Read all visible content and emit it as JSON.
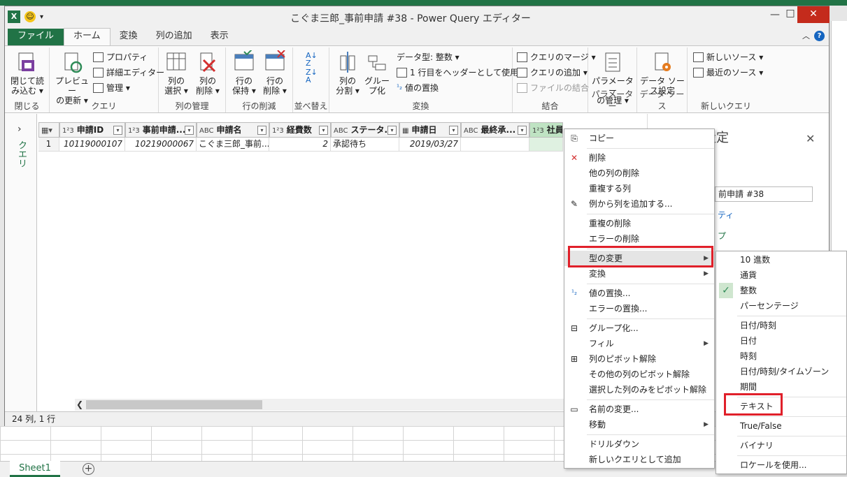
{
  "window": {
    "title": "こぐま三郎_事前申請 #38 - Power Query エディター",
    "min": "—",
    "max": "□",
    "close": "✕"
  },
  "tabs": [
    {
      "label": "ファイル"
    },
    {
      "label": "ホーム"
    },
    {
      "label": "変換"
    },
    {
      "label": "列の追加"
    },
    {
      "label": "表示"
    }
  ],
  "ribbon": {
    "close_load": "閉じて読\nみ込む ▾",
    "group_close": "閉じる",
    "preview_refresh": "プレビュー\nの更新 ▾",
    "properties": "プロパティ",
    "advanced_editor": "詳細エディター",
    "manage": "管理 ▾",
    "group_query": "クエリ",
    "choose_columns": "列の\n選択 ▾",
    "remove_columns": "列の\n削除 ▾",
    "group_manage_cols": "列の管理",
    "keep_rows": "行の\n保持 ▾",
    "remove_rows": "行の\n削除 ▾",
    "group_reduce_rows": "行の削減",
    "group_sort": "並べ替え",
    "split_column": "列の\n分割 ▾",
    "group_by": "グルー\nプ化",
    "data_type": "データ型: 整数 ▾",
    "use_first_row": "1 行目をヘッダーとして使用 ▾",
    "replace_values": "値の置換",
    "group_transform": "変換",
    "merge_queries": "クエリのマージ ▾",
    "append_queries": "クエリの追加 ▾",
    "combine_files": "ファイルの結合",
    "group_combine": "結合",
    "manage_params": "パラメーター\nの管理 ▾",
    "group_params": "パラメーター",
    "data_source_settings": "データ ソー\nス設定",
    "group_data_sources": "データ ソース",
    "new_source": "新しいソース ▾",
    "recent_sources": "最近のソース ▾",
    "group_new_query": "新しいクエリ"
  },
  "queries_label": "クエリ",
  "columns": [
    {
      "type": "1²3",
      "name": "申請ID"
    },
    {
      "type": "1²3",
      "name": "事前申請..."
    },
    {
      "type": "ABC",
      "name": "申請名"
    },
    {
      "type": "1²3",
      "name": "経費数"
    },
    {
      "type": "ABC",
      "name": "ステータ..."
    },
    {
      "type": "▦",
      "name": "申請日"
    },
    {
      "type": "ABC",
      "name": "最終承..."
    },
    {
      "type": "1²3",
      "name": "社員番..."
    }
  ],
  "row": {
    "index": "1",
    "cells": [
      "10119000107",
      "10219000067",
      "こぐま三郎_事前...",
      "2",
      "承認待ち",
      "2019/03/27",
      "",
      ""
    ]
  },
  "status": "24 列, 1 行",
  "settings": {
    "title": "クエリの設定",
    "name_value": "前申請 #38",
    "props_link": "ティ",
    "steps_label": "プ"
  },
  "context_menu": [
    {
      "label": "コピー",
      "icon": "⎘"
    },
    {
      "label": "削除",
      "icon": "✕"
    },
    {
      "label": "他の列の削除",
      "icon": ""
    },
    {
      "label": "重複する列",
      "icon": ""
    },
    {
      "label": "例から列を追加する...",
      "icon": "✎"
    },
    {
      "label": "重複の削除",
      "icon": ""
    },
    {
      "label": "エラーの削除",
      "icon": ""
    },
    {
      "label": "型の変更",
      "icon": ""
    },
    {
      "label": "変換",
      "icon": ""
    },
    {
      "label": "値の置換...",
      "icon": "¹₂"
    },
    {
      "label": "エラーの置換...",
      "icon": ""
    },
    {
      "label": "グループ化...",
      "icon": "⊟"
    },
    {
      "label": "フィル",
      "icon": ""
    },
    {
      "label": "列のピボット解除",
      "icon": "⊞"
    },
    {
      "label": "その他の列のピボット解除",
      "icon": ""
    },
    {
      "label": "選択した列のみをピボット解除",
      "icon": ""
    },
    {
      "label": "名前の変更...",
      "icon": "▭"
    },
    {
      "label": "移動",
      "icon": ""
    },
    {
      "label": "ドリルダウン",
      "icon": ""
    },
    {
      "label": "新しいクエリとして追加",
      "icon": ""
    }
  ],
  "submenu": [
    "10 進数",
    "通貨",
    "整数",
    "パーセンテージ",
    "日付/時刻",
    "日付",
    "時刻",
    "日付/時刻/タイムゾーン",
    "期間",
    "テキスト",
    "True/False",
    "バイナリ",
    "ロケールを使用..."
  ],
  "excel": {
    "sheet": "Sheet1"
  },
  "colors": {
    "excel_green": "#217346",
    "highlight_red": "#e0202a"
  }
}
